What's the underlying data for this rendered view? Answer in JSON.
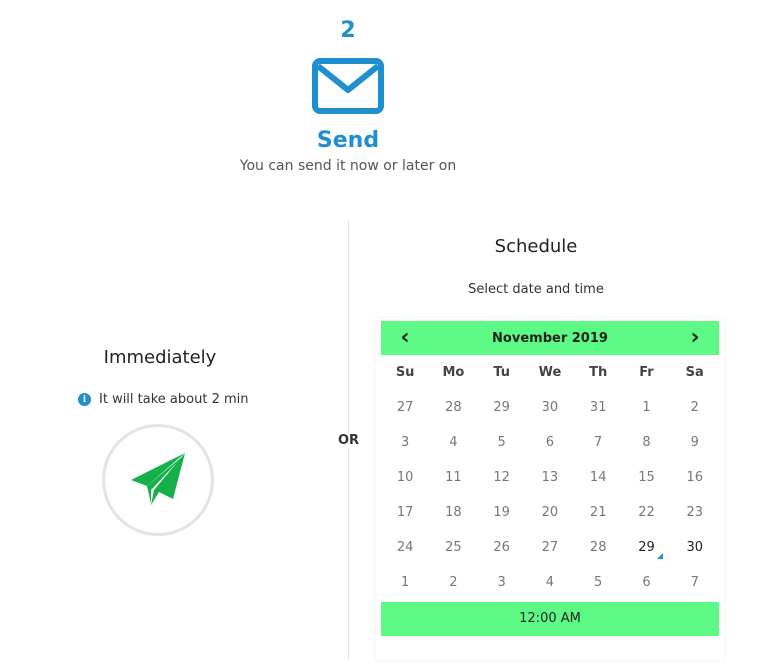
{
  "step": {
    "number": "2",
    "title": "Send",
    "subtitle": "You can send it now or later on"
  },
  "or_label": "OR",
  "immediately": {
    "title": "Immediately",
    "info": "It will take about 2 min"
  },
  "schedule": {
    "title": "Schedule",
    "subtitle": "Select date and time",
    "calendar": {
      "prev": "‹",
      "next": "›",
      "month_label": "November 2019",
      "weekdays": [
        "Su",
        "Mo",
        "Tu",
        "We",
        "Th",
        "Fr",
        "Sa"
      ],
      "weeks": [
        [
          "27",
          "28",
          "29",
          "30",
          "31",
          "1",
          "2"
        ],
        [
          "3",
          "4",
          "5",
          "6",
          "7",
          "8",
          "9"
        ],
        [
          "10",
          "11",
          "12",
          "13",
          "14",
          "15",
          "16"
        ],
        [
          "17",
          "18",
          "19",
          "20",
          "21",
          "22",
          "23"
        ],
        [
          "24",
          "25",
          "26",
          "27",
          "28",
          "29",
          "30"
        ],
        [
          "1",
          "2",
          "3",
          "4",
          "5",
          "6",
          "7"
        ]
      ],
      "today": "29",
      "time": "12:00 AM"
    }
  },
  "colors": {
    "accent_blue": "#1f8fd0",
    "calendar_green": "#5cfa84",
    "send_green": "#16b04a"
  }
}
